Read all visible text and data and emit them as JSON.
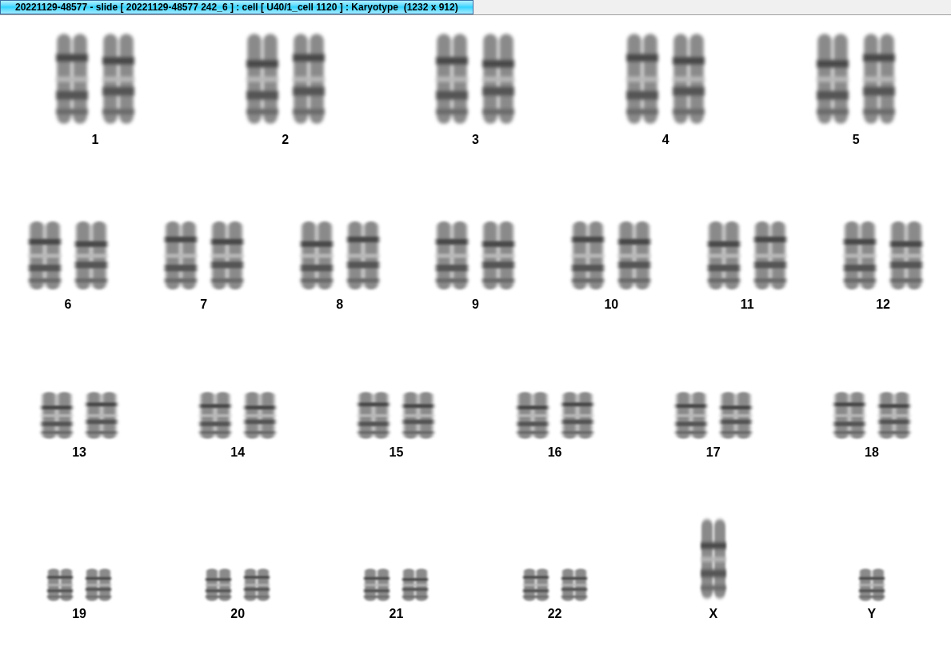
{
  "window": {
    "title": "20221129-48577 - slide [ 20221129-48577 242_6 ] : cell [ U40/1_cell 1120 ] : Karyotype  (1232 x 912)"
  },
  "karyotype": {
    "rows": [
      [
        {
          "label": "1",
          "kind": "pair"
        },
        {
          "label": "2",
          "kind": "pair"
        },
        {
          "label": "3",
          "kind": "pair"
        },
        {
          "label": "4",
          "kind": "pair"
        },
        {
          "label": "5",
          "kind": "pair"
        }
      ],
      [
        {
          "label": "6",
          "kind": "pair"
        },
        {
          "label": "7",
          "kind": "pair"
        },
        {
          "label": "8",
          "kind": "pair"
        },
        {
          "label": "9",
          "kind": "pair"
        },
        {
          "label": "10",
          "kind": "pair"
        },
        {
          "label": "11",
          "kind": "pair"
        },
        {
          "label": "12",
          "kind": "pair"
        }
      ],
      [
        {
          "label": "13",
          "kind": "pair"
        },
        {
          "label": "14",
          "kind": "pair"
        },
        {
          "label": "15",
          "kind": "pair"
        },
        {
          "label": "16",
          "kind": "pair"
        },
        {
          "label": "17",
          "kind": "pair"
        },
        {
          "label": "18",
          "kind": "pair"
        }
      ],
      [
        {
          "label": "19",
          "kind": "pair"
        },
        {
          "label": "20",
          "kind": "pair"
        },
        {
          "label": "21",
          "kind": "pair"
        },
        {
          "label": "22",
          "kind": "pair"
        },
        {
          "label": "X",
          "kind": "single"
        },
        {
          "label": "Y",
          "kind": "single"
        }
      ]
    ]
  }
}
